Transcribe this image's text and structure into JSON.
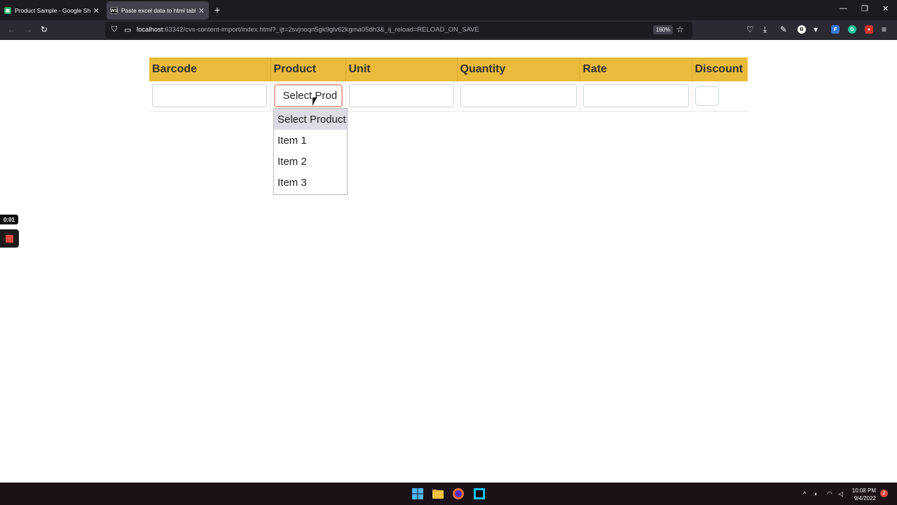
{
  "browser": {
    "tabs": [
      {
        "title": "Product Sample - Google Sheets",
        "active": false,
        "icon": "google-sheets-icon",
        "icon_color": "#1fa463"
      },
      {
        "title": "Paste excel data to html table",
        "active": true,
        "icon": "webstorm-icon",
        "icon_color": "#3b3b3b"
      }
    ],
    "url_host": "localhost",
    "url_rest": ":63342/cvs-content-import/index.html?_ijt=2svjnoqn5gk9glv62kgma05dh3&_ij_reload=RELOAD_ON_SAVE",
    "zoom": "160%"
  },
  "table": {
    "headers": {
      "barcode": "Barcode",
      "product": "Product",
      "unit": "Unit",
      "quantity": "Quantity",
      "rate": "Rate",
      "discount": "Discount"
    },
    "header_color": "#e9bb3c",
    "row": {
      "barcode": "",
      "product_select": "Select Prod",
      "unit": "",
      "quantity": "",
      "rate": "",
      "discount": ""
    }
  },
  "dropdown": {
    "options": [
      "Select Product",
      "Item 1",
      "Item 2",
      "Item 3"
    ],
    "selected_index": 0
  },
  "recorder": {
    "timer": "0:01"
  },
  "taskbar": {
    "time": "10:08 PM",
    "date": "9/4/2022",
    "notifications": "2"
  }
}
